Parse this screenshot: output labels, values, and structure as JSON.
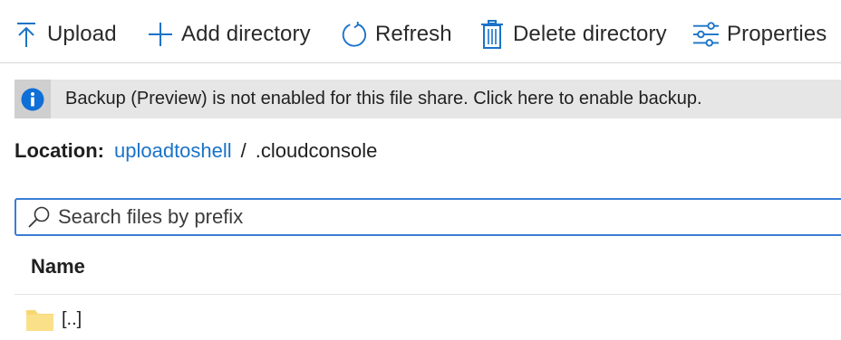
{
  "toolbar": {
    "upload": {
      "label": "Upload",
      "icon": "upload-icon"
    },
    "add_directory": {
      "label": "Add directory",
      "icon": "plus-icon"
    },
    "refresh": {
      "label": "Refresh",
      "icon": "refresh-icon"
    },
    "delete_directory": {
      "label": "Delete directory",
      "icon": "trash-icon"
    },
    "properties": {
      "label": "Properties",
      "icon": "sliders-icon"
    }
  },
  "banner": {
    "icon": "info-icon",
    "text": "Backup (Preview) is not enabled for this file share. Click here to enable backup."
  },
  "location": {
    "label": "Location:",
    "share_link": "uploadtoshell",
    "separator": "/",
    "current": ".cloudconsole"
  },
  "search": {
    "placeholder": "Search files by prefix",
    "value": "",
    "icon": "search-icon"
  },
  "table": {
    "columns": [
      "Name"
    ],
    "rows": [
      {
        "name": "[..]",
        "icon": "folder-icon"
      }
    ]
  },
  "colors": {
    "accent": "#1a73c8",
    "link": "#1a73c8",
    "info_blue": "#0f6fd6",
    "banner_bg": "#e6e6e6",
    "folder": "#f7d873"
  }
}
